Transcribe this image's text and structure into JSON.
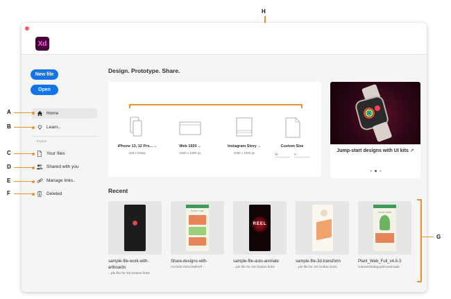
{
  "callouts": {
    "a": "A",
    "b": "B",
    "c": "C",
    "d": "D",
    "e": "E",
    "f": "F",
    "g": "G",
    "h": "H"
  },
  "app": {
    "logo_text": "Xd"
  },
  "sidebar": {
    "new_file_label": "New file",
    "open_label": "Open",
    "items": [
      {
        "label": "Home",
        "icon": "home-icon"
      },
      {
        "label": "Learn..",
        "icon": "lightbulb-icon"
      }
    ],
    "files_section_label": "FILES",
    "file_items": [
      {
        "label": "Your files",
        "icon": "document-icon"
      },
      {
        "label": "Shared with you",
        "icon": "people-icon"
      },
      {
        "label": "Manage links..",
        "icon": "link-icon"
      },
      {
        "label": "Deleted",
        "icon": "trash-icon"
      }
    ]
  },
  "main": {
    "heading": "Design. Prototype. Share.",
    "presets": [
      {
        "name": "iPhone 13, 12 Pro...",
        "size": "428 x 926px"
      },
      {
        "name": "Web 1920",
        "size": "1920 x 1080 px"
      },
      {
        "name": "Instagram Story",
        "size": "1080 x 1920 px"
      },
      {
        "name": "Custom Size",
        "width_label": "W",
        "height_label": "H"
      }
    ],
    "promo": {
      "title": "Jump-start designs with UI kits",
      "external_icon": "external-link-icon",
      "page_count": 3,
      "active_page": 2
    },
    "recent_heading": "Recent",
    "recent": [
      {
        "name": "sample-file-work-with-artboards",
        "sub": "...ple file for XD broken links"
      },
      {
        "name": "Share-designs-with-",
        "sub": "CLOUD DOCUMENT"
      },
      {
        "name": "sample-file-auto-animate",
        "sub": "...ple file for XD broken links"
      },
      {
        "name": "sample-file-3d-transform",
        "sub": "...ple file for XD broken links"
      },
      {
        "name": "Plant_Web_Full_v4.5-3",
        "sub": "/Users/shalegup/Downloads"
      }
    ],
    "thumb_text": {
      "reel": "REEL",
      "plant_care": "PLANT CARE",
      "plant_name": "PLANT NAME"
    }
  },
  "colors": {
    "accent": "#1473e6",
    "callout": "#e8912d",
    "xd_brand": "#470137",
    "xd_brand_text": "#ff61f6"
  }
}
